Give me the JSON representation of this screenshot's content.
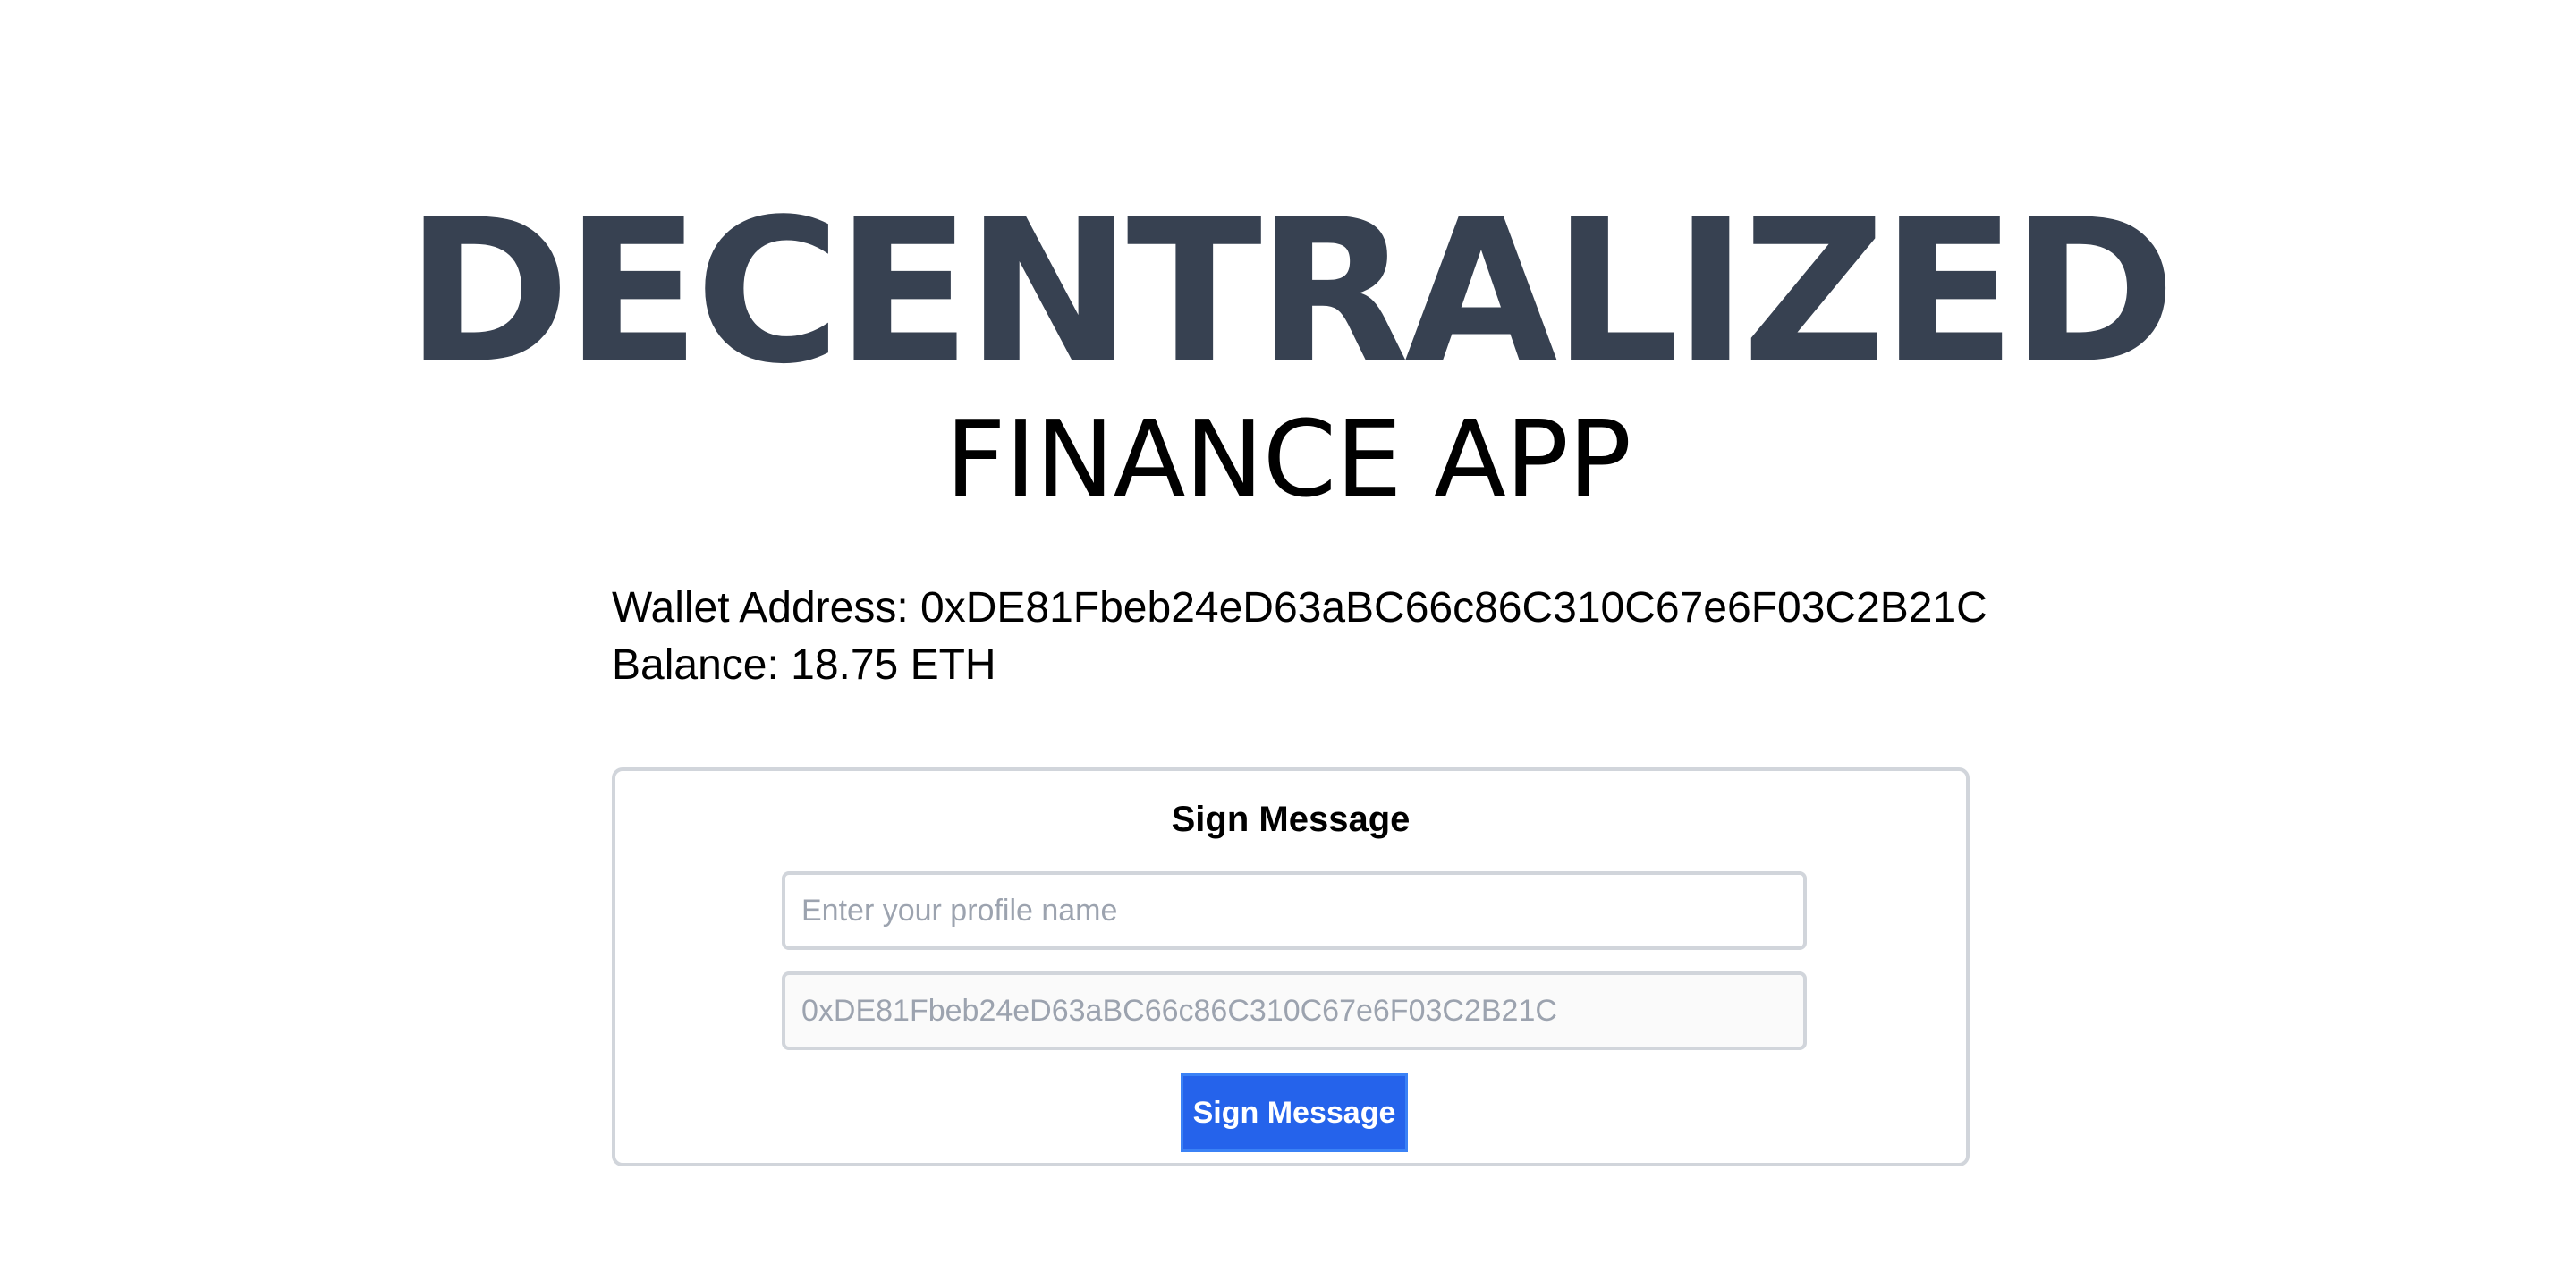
{
  "header": {
    "title": "DECENTRALIZED",
    "subtitle": "FINANCE APP"
  },
  "wallet": {
    "address_label": "Wallet Address: 0xDE81Fbeb24eD63aBC66c86C310C67e6F03C2B21C",
    "balance_label": "Balance: 18.75 ETH"
  },
  "sign_form": {
    "title": "Sign Message",
    "profile_input": {
      "value": "",
      "placeholder": "Enter your profile name"
    },
    "address_input": {
      "value": "0xDE81Fbeb24eD63aBC66c86C310C67e6F03C2B21C",
      "placeholder": ""
    },
    "submit_label": "Sign Message"
  },
  "colors": {
    "title": "#374151",
    "button": "#2563eb",
    "border": "#d1d5db"
  }
}
